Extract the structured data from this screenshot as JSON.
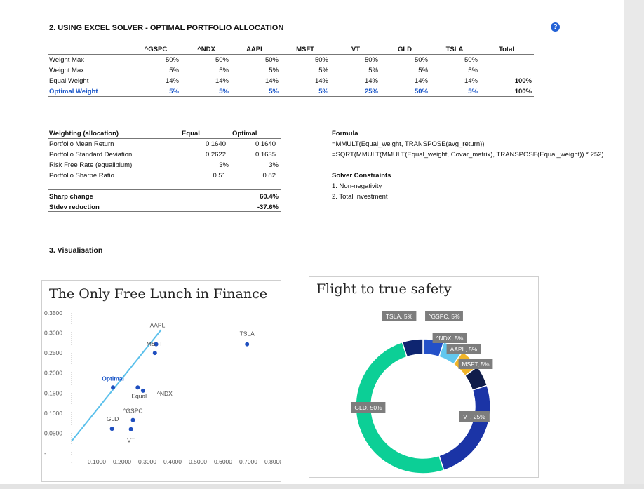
{
  "section2_title": "2. USING EXCEL SOLVER - OPTIMAL PORTFOLIO ALLOCATION",
  "help_icon": "?",
  "weights": {
    "headers": [
      "^GSPC",
      "^NDX",
      "AAPL",
      "MSFT",
      "VT",
      "GLD",
      "TSLA",
      "Total"
    ],
    "rows": [
      {
        "label": "Weight Max",
        "values": [
          "50%",
          "50%",
          "50%",
          "50%",
          "50%",
          "50%",
          "50%",
          ""
        ]
      },
      {
        "label": "Weight Max",
        "values": [
          "5%",
          "5%",
          "5%",
          "5%",
          "5%",
          "5%",
          "5%",
          ""
        ]
      },
      {
        "label": "Equal Weight",
        "values": [
          "14%",
          "14%",
          "14%",
          "14%",
          "14%",
          "14%",
          "14%",
          "100%"
        ]
      },
      {
        "label": "Optimal Weight",
        "values": [
          "5%",
          "5%",
          "5%",
          "5%",
          "25%",
          "50%",
          "5%",
          "100%"
        ]
      }
    ]
  },
  "stats": {
    "headers": [
      "Weighting (allocation)",
      "Equal",
      "Optimal"
    ],
    "rows": [
      {
        "label": "Portfolio Mean Return",
        "equal": "0.1640",
        "optimal": "0.1640"
      },
      {
        "label": "Portfolio Standard Deviation",
        "equal": "0.2622",
        "optimal": "0.1635"
      },
      {
        "label": "Risk Free Rate (equalibium)",
        "equal": "3%",
        "optimal": "3%"
      },
      {
        "label": "Portfolio Sharpe Ratio",
        "equal": "0.51",
        "optimal": "0.82"
      }
    ],
    "changes": [
      {
        "label": "Sharp change",
        "value": "60.4%"
      },
      {
        "label": "Stdev reduction",
        "value": "-37.6%"
      }
    ]
  },
  "formula": {
    "title": "Formula",
    "lines": [
      "=MMULT(Equal_weight, TRANSPOSE(avg_return))",
      "=SQRT(MMULT(MMULT(Equal_weight, Covar_matrix), TRANSPOSE(Equal_weight)) * 252)"
    ]
  },
  "constraints": {
    "title": "Solver Constraints",
    "items": [
      "1. Non-negativity",
      "2. Total Investment"
    ]
  },
  "section3_title": "3. Visualisation",
  "chart_data": [
    {
      "type": "scatter",
      "title": "The Only Free Lunch in Finance",
      "xlabel": "",
      "ylabel": "",
      "xlim": [
        0.0,
        0.8
      ],
      "ylim": [
        0.0,
        0.35
      ],
      "x_ticks": [
        "-",
        "0.1000",
        "0.2000",
        "0.3000",
        "0.4000",
        "0.5000",
        "0.6000",
        "0.7000",
        "0.8000"
      ],
      "y_ticks": [
        "-",
        "0.0500",
        "0.1000",
        "0.1500",
        "0.2000",
        "0.2500",
        "0.3000",
        "0.3500"
      ],
      "grid": false,
      "points": [
        {
          "label": "AAPL",
          "x": 0.335,
          "y": 0.272
        },
        {
          "label": "MSFT",
          "x": 0.33,
          "y": 0.25
        },
        {
          "label": "TSLA",
          "x": 0.695,
          "y": 0.272
        },
        {
          "label": "Optimal",
          "x": 0.164,
          "y": 0.164
        },
        {
          "label": "Equal",
          "x": 0.262,
          "y": 0.164
        },
        {
          "label": "^NDX",
          "x": 0.283,
          "y": 0.156
        },
        {
          "label": "^GSPC",
          "x": 0.243,
          "y": 0.083
        },
        {
          "label": "GLD",
          "x": 0.16,
          "y": 0.061
        },
        {
          "label": "VT",
          "x": 0.235,
          "y": 0.06
        }
      ],
      "line": {
        "x": [
          0.0,
          0.355
        ],
        "y": [
          0.03,
          0.308
        ]
      },
      "colors": {
        "points": "#1f4fbf",
        "optimal_label": "#1a56c8",
        "line": "#5bc0eb"
      }
    },
    {
      "type": "pie",
      "title": "Flight to true safety",
      "donut": true,
      "slices": [
        {
          "label": "^GSPC",
          "value": 5,
          "display": "^GSPC, 5%",
          "color": "#2350c8"
        },
        {
          "label": "^NDX",
          "value": 5,
          "display": "^NDX, 5%",
          "color": "#62c7ee"
        },
        {
          "label": "AAPL",
          "value": 5,
          "display": "AAPL, 5%",
          "color": "#f0b429"
        },
        {
          "label": "MSFT",
          "value": 5,
          "display": "MSFT, 5%",
          "color": "#101d4a"
        },
        {
          "label": "VT",
          "value": 25,
          "display": "VT, 25%",
          "color": "#1b34a6"
        },
        {
          "label": "GLD",
          "value": 50,
          "display": "GLD, 50%",
          "color": "#0ccf96"
        },
        {
          "label": "TSLA",
          "value": 5,
          "display": "TSLA, 5%",
          "color": "#0e2570"
        }
      ]
    }
  ]
}
